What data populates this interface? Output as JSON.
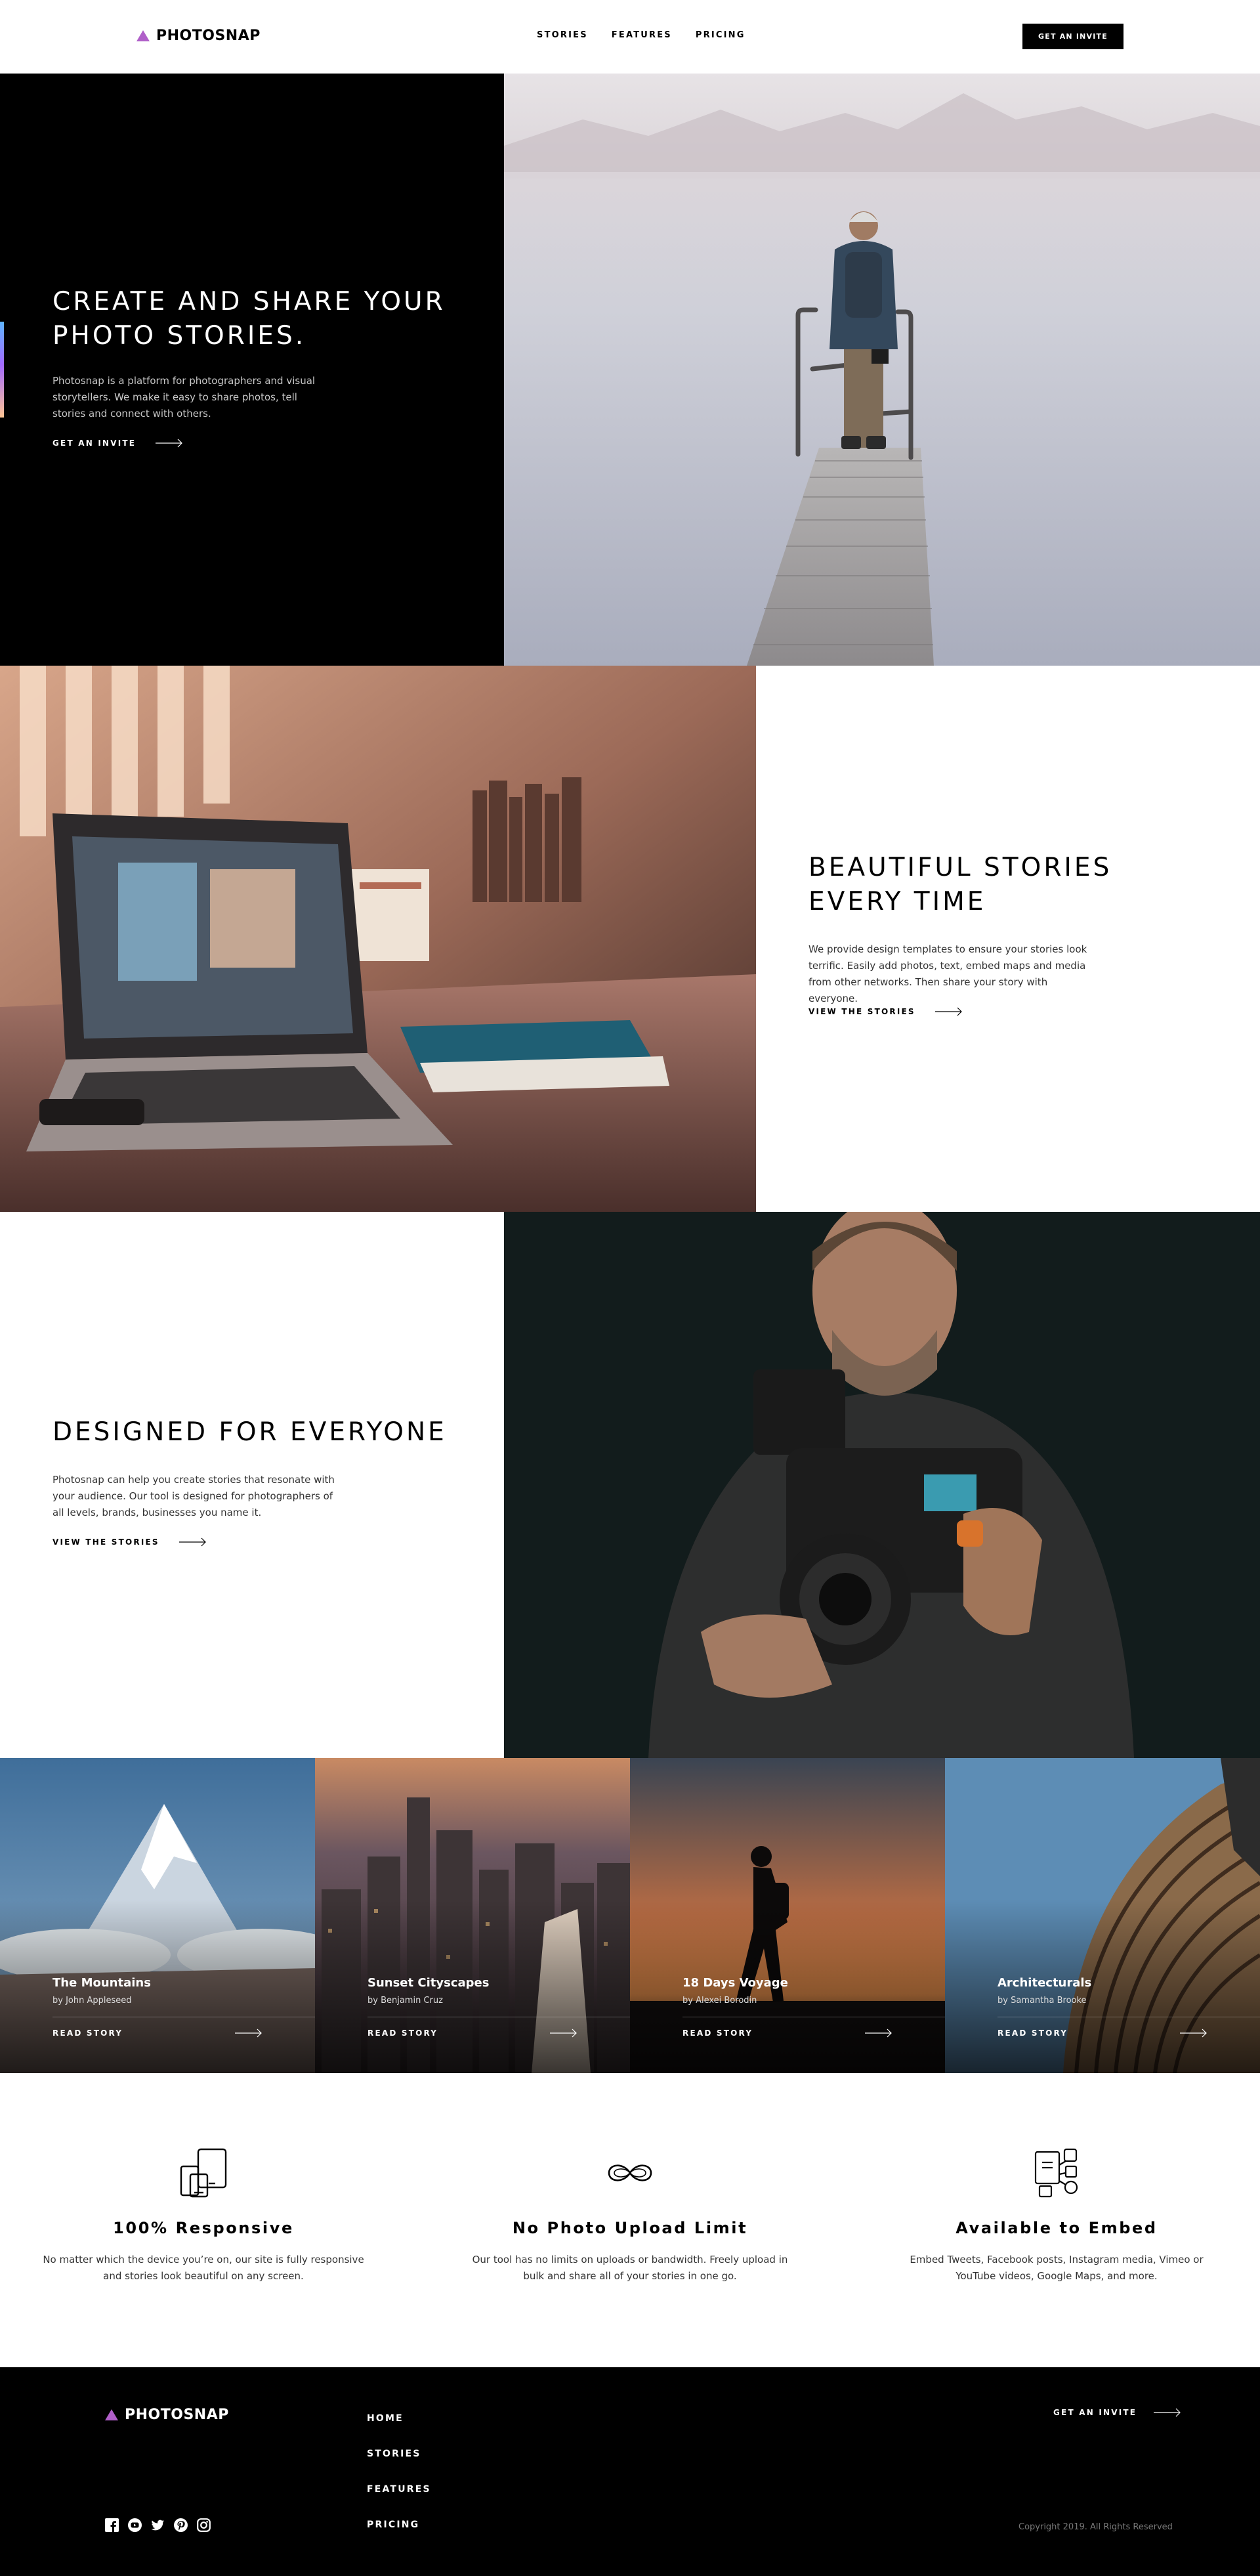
{
  "header": {
    "brand": "PHOTOSNAP",
    "nav": [
      "STORIES",
      "FEATURES",
      "PRICING"
    ],
    "cta": "GET AN INVITE"
  },
  "hero": {
    "title": "CREATE AND SHARE YOUR PHOTO STORIES.",
    "text": "Photosnap is a platform for photographers and visual storytellers. We make it easy to share photos, tell stories and connect with others.",
    "link": "GET AN INVITE"
  },
  "beautiful": {
    "title": "BEAUTIFUL STORIES EVERY TIME",
    "text": "We provide design templates to ensure your stories look terrific. Easily add photos, text, embed maps and media from other networks. Then share your story with everyone.",
    "link": "VIEW THE STORIES"
  },
  "designed": {
    "title": "DESIGNED FOR EVERYONE",
    "text": "Photosnap can help you create stories that resonate with your audience. Our tool is designed for photographers of all levels, brands, businesses you name it.",
    "link": "VIEW THE STORIES"
  },
  "stories": [
    {
      "title": "The Mountains",
      "author": "by John Appleseed",
      "link": "READ STORY"
    },
    {
      "title": "Sunset Cityscapes",
      "author": "by Benjamin Cruz",
      "link": "READ STORY"
    },
    {
      "title": "18 Days Voyage",
      "author": "by Alexei Borodin",
      "link": "READ STORY"
    },
    {
      "title": "Architecturals",
      "author": "by Samantha Brooke",
      "link": "READ STORY"
    }
  ],
  "features": [
    {
      "icon": "responsive-devices-icon",
      "title": "100% Responsive",
      "text": "No matter which the device you’re on, our site is fully responsive and stories look beautiful on any screen."
    },
    {
      "icon": "infinity-icon",
      "title": "No Photo Upload Limit",
      "text": "Our tool has no limits on uploads or bandwidth. Freely upload in bulk and share all of your stories in one go."
    },
    {
      "icon": "embed-media-icon",
      "title": "Available to Embed",
      "text": "Embed Tweets, Facebook posts, Instagram media, Vimeo or YouTube videos, Google Maps, and more."
    }
  ],
  "footer": {
    "brand": "PHOTOSNAP",
    "nav": [
      "HOME",
      "STORIES",
      "FEATURES",
      "PRICING"
    ],
    "cta": "GET AN INVITE",
    "copyright": "Copyright 2019. All Rights Reserved",
    "social": [
      "facebook-icon",
      "youtube-icon",
      "twitter-icon",
      "pinterest-icon",
      "instagram-icon"
    ]
  },
  "colors": {
    "accent_gradient": [
      "#5eb5ff",
      "#a26aff",
      "#ffc593"
    ],
    "logo_triangle": "#b05fc9",
    "dark": "#000000"
  }
}
